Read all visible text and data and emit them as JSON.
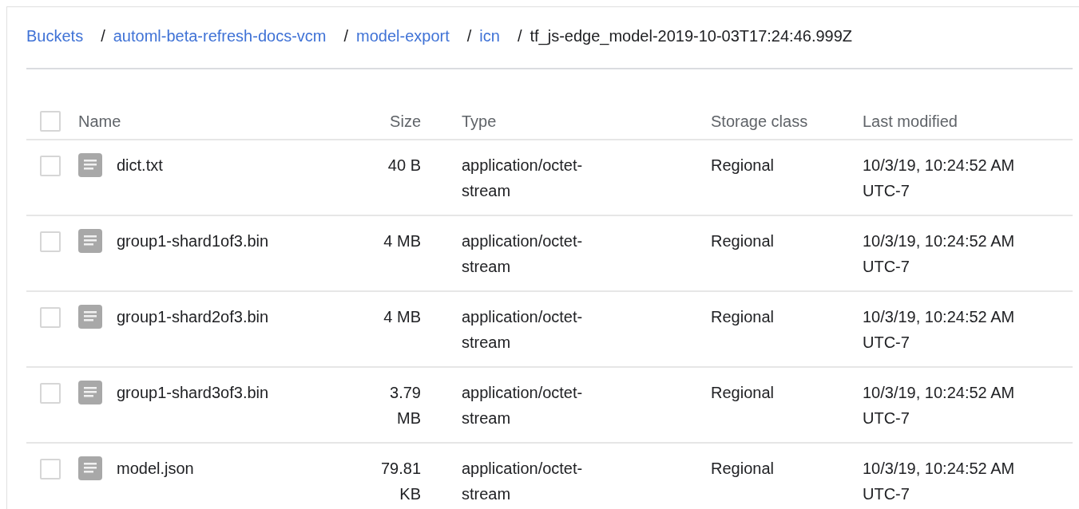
{
  "breadcrumb": [
    {
      "label": "Buckets",
      "kind": "link"
    },
    {
      "separator": "/",
      "label": "automl-beta-refresh-docs-vcm",
      "kind": "link"
    },
    {
      "separator": "/",
      "label": "model-export",
      "kind": "link"
    },
    {
      "separator": "/",
      "label": "icn",
      "kind": "link"
    },
    {
      "separator": "/",
      "label": "tf_js-edge_model-2019-10-03T17:24:46.999Z",
      "kind": "current"
    }
  ],
  "table": {
    "select_all": {
      "checked": false
    },
    "columns": [
      "Name",
      "Size",
      "Type",
      "Storage class",
      "Last modified"
    ],
    "rows": [
      {
        "checked": false,
        "name": "dict.txt",
        "size": "40 B",
        "type": "application/octet-stream",
        "storage_class": "Regional",
        "last_modified": "10/3/19, 10:24:52 AM UTC-7"
      },
      {
        "checked": false,
        "name": "group1-shard1of3.bin",
        "size": "4 MB",
        "type": "application/octet-stream",
        "storage_class": "Regional",
        "last_modified": "10/3/19, 10:24:52 AM UTC-7"
      },
      {
        "checked": false,
        "name": "group1-shard2of3.bin",
        "size": "4 MB",
        "type": "application/octet-stream",
        "storage_class": "Regional",
        "last_modified": "10/3/19, 10:24:52 AM UTC-7"
      },
      {
        "checked": false,
        "name": "group1-shard3of3.bin",
        "size": "3.79 MB",
        "type": "application/octet-stream",
        "storage_class": "Regional",
        "last_modified": "10/3/19, 10:24:52 AM UTC-7"
      },
      {
        "checked": false,
        "name": "model.json",
        "size": "79.81 KB",
        "type": "application/octet-stream",
        "storage_class": "Regional",
        "last_modified": "10/3/19, 10:24:52 AM UTC-7"
      }
    ]
  }
}
